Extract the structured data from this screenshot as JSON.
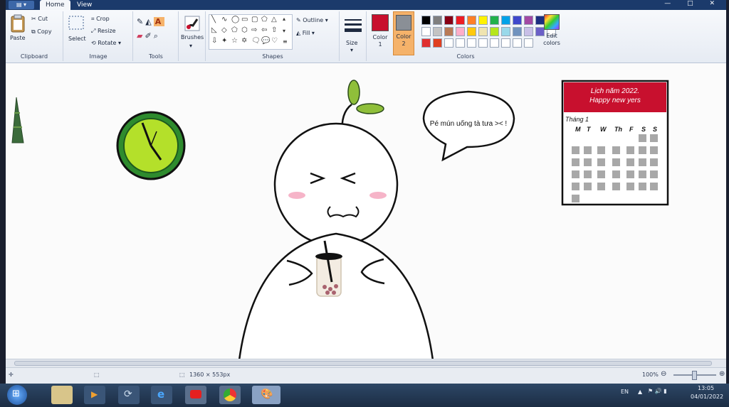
{
  "tabs": {
    "home": "Home",
    "view": "View"
  },
  "clipboard": {
    "paste": "Paste",
    "cut": "Cut",
    "copy": "Copy",
    "label": "Clipboard"
  },
  "image": {
    "select": "Select",
    "crop": "Crop",
    "resize": "Resize",
    "rotate": "Rotate",
    "label": "Image"
  },
  "tools": {
    "label": "Tools",
    "text_tool": "A"
  },
  "brushes": {
    "label": "Brushes"
  },
  "shapes": {
    "outline": "Outline",
    "fill": "Fill",
    "label": "Shapes"
  },
  "size": {
    "label": "Size"
  },
  "colors": {
    "color1_label": "Color\n1",
    "color2_label": "Color\n2",
    "edit_label": "Edit\ncolors",
    "label": "Colors",
    "color1": "#c8102e",
    "color2": "#8a8f96",
    "palette_row1": [
      "#000000",
      "#7f7f7f",
      "#880015",
      "#ed1c24",
      "#ff7f27",
      "#fff200",
      "#22b14c",
      "#00a2e8",
      "#3f48cc",
      "#a349a4",
      "#1c2e80",
      "#222222"
    ],
    "palette_row2": [
      "#ffffff",
      "#c3c3c3",
      "#b97a57",
      "#ffaec9",
      "#ffc90e",
      "#efe4b0",
      "#b5e61d",
      "#99d9ea",
      "#7092be",
      "#c8bfe7",
      "#6b5fc7",
      "#ffffff"
    ],
    "palette_row3": [
      "#e03030",
      "#e04020",
      "#ffffff",
      "#ffffff",
      "#ffffff",
      "#ffffff",
      "#ffffff",
      "#ffffff",
      "#ffffff",
      "#ffffff"
    ]
  },
  "drawing": {
    "speech": "Pé mún uống tà tưa >< !",
    "calendar_title": "Lịch năm 2022.",
    "calendar_subtitle": "Happy new yers",
    "calendar_month": "Tháng 1",
    "weekdays": [
      "M",
      "T",
      "W",
      "Th",
      "F",
      "S",
      "S"
    ]
  },
  "status": {
    "dimensions": "1360 × 553px",
    "zoom": "100%"
  },
  "tray": {
    "lang": "EN",
    "time": "13:05",
    "date": "04/01/2022"
  }
}
